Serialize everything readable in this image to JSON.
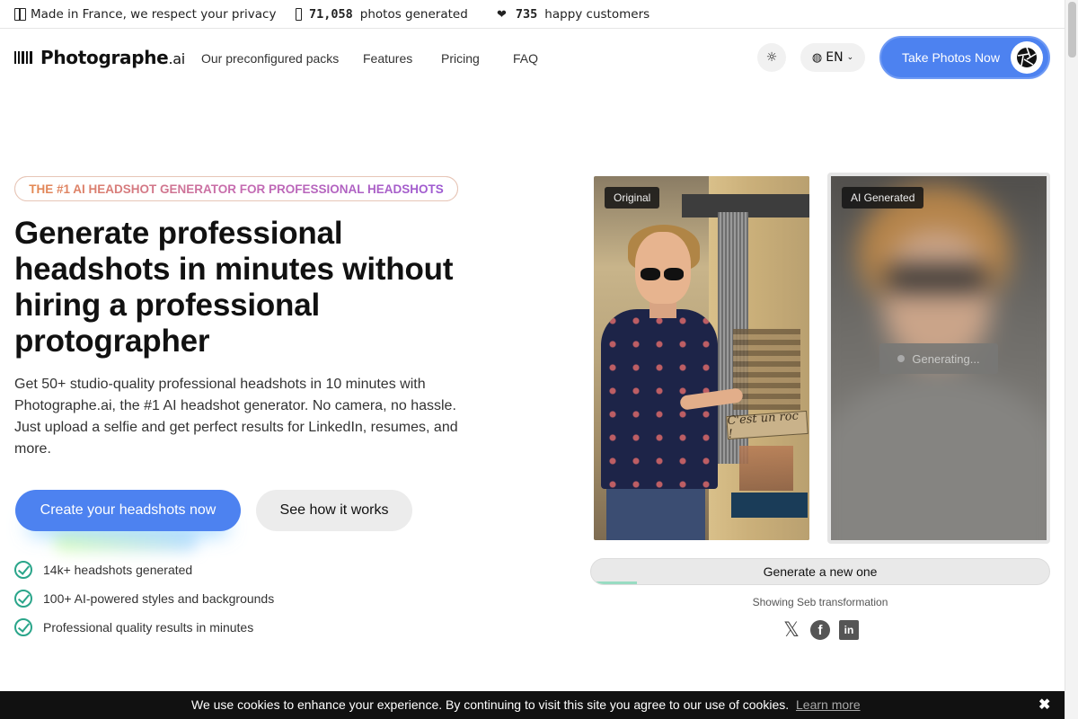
{
  "topbar": {
    "privacy": "Made in France, we respect your privacy",
    "photos_count": "71,058",
    "photos_label": "photos generated",
    "customers_count": "735",
    "customers_label": "happy customers"
  },
  "header": {
    "logo_main": "Photographe",
    "logo_suffix": ".ai",
    "nav": [
      "Our preconfigured packs",
      "Features",
      "Pricing",
      "FAQ"
    ],
    "language": "EN",
    "cta": "Take Photos Now"
  },
  "hero": {
    "badge": "THE #1 AI HEADSHOT GENERATOR FOR PROFESSIONAL HEADSHOTS",
    "title": "Generate professional headshots in minutes without hiring a professional protographer",
    "lead": "Get 50+ studio-quality professional headshots in 10 minutes with Photographe.ai, the #1 AI headshot generator. No camera, no hassle. Just upload a selfie and get perfect results for LinkedIn, resumes, and more.",
    "primary_button": "Create your headshots now",
    "secondary_button": "See how it works",
    "features": [
      "14k+ headshots generated",
      "100+ AI-powered styles and backgrounds",
      "Professional quality results in minutes"
    ]
  },
  "showcase": {
    "original_tag": "Original",
    "ai_tag": "AI Generated",
    "sign_text": "C'est un roc !",
    "generating": "Generating...",
    "generate_button": "Generate a new one",
    "generate_progress": 0.1,
    "caption": "Showing Seb transformation"
  },
  "cookie": {
    "message": "We use cookies to enhance your experience. By continuing to visit this site you agree to our use of cookies.",
    "learn_more": "Learn more",
    "close": "✖"
  },
  "colors": {
    "accent": "#4d82f0",
    "check": "#2aa58a",
    "cookie_bg": "#111111"
  }
}
